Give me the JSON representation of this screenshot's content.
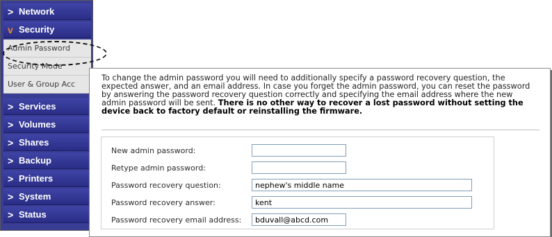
{
  "sidebar": {
    "sections_top": [
      {
        "label": "Network",
        "expanded": false
      },
      {
        "label": "Security",
        "expanded": true
      }
    ],
    "sub_items": [
      {
        "label": "Admin Password",
        "selected": true
      },
      {
        "label": "Security Mode",
        "selected": false
      },
      {
        "label": "User & Group Acc",
        "selected": false
      }
    ],
    "sections_bottom": [
      {
        "label": "Services"
      },
      {
        "label": "Volumes"
      },
      {
        "label": "Shares"
      },
      {
        "label": "Backup"
      },
      {
        "label": "Printers"
      },
      {
        "label": "System"
      },
      {
        "label": "Status"
      }
    ],
    "collapsed_glyph": ">",
    "expanded_glyph": "v"
  },
  "main": {
    "intro_text": "To change the admin password you will need to additionally specify a password recovery question, the expected answer, and an email address. In case you forget the admin password, you can reset the password by answering the password recovery question correctly and specifying the email address where the new admin password will be sent. ",
    "intro_bold": "There is no other way to recover a lost password without setting the device back to factory default or reinstalling the firmware.",
    "form": {
      "new_password": {
        "label": "New admin password:",
        "value": ""
      },
      "retype_password": {
        "label": "Retype admin password:",
        "value": ""
      },
      "recovery_question": {
        "label": "Password recovery question:",
        "value": "nephew's middle name"
      },
      "recovery_answer": {
        "label": "Password recovery answer:",
        "value": "kent"
      },
      "recovery_email": {
        "label": "Password recovery email address:",
        "value": "bduvall@abcd.com"
      }
    }
  },
  "colors": {
    "nav_background": "#2f3390",
    "expanded_chevron": "#f08a1c",
    "submenu_background": "#e6e6e6"
  }
}
